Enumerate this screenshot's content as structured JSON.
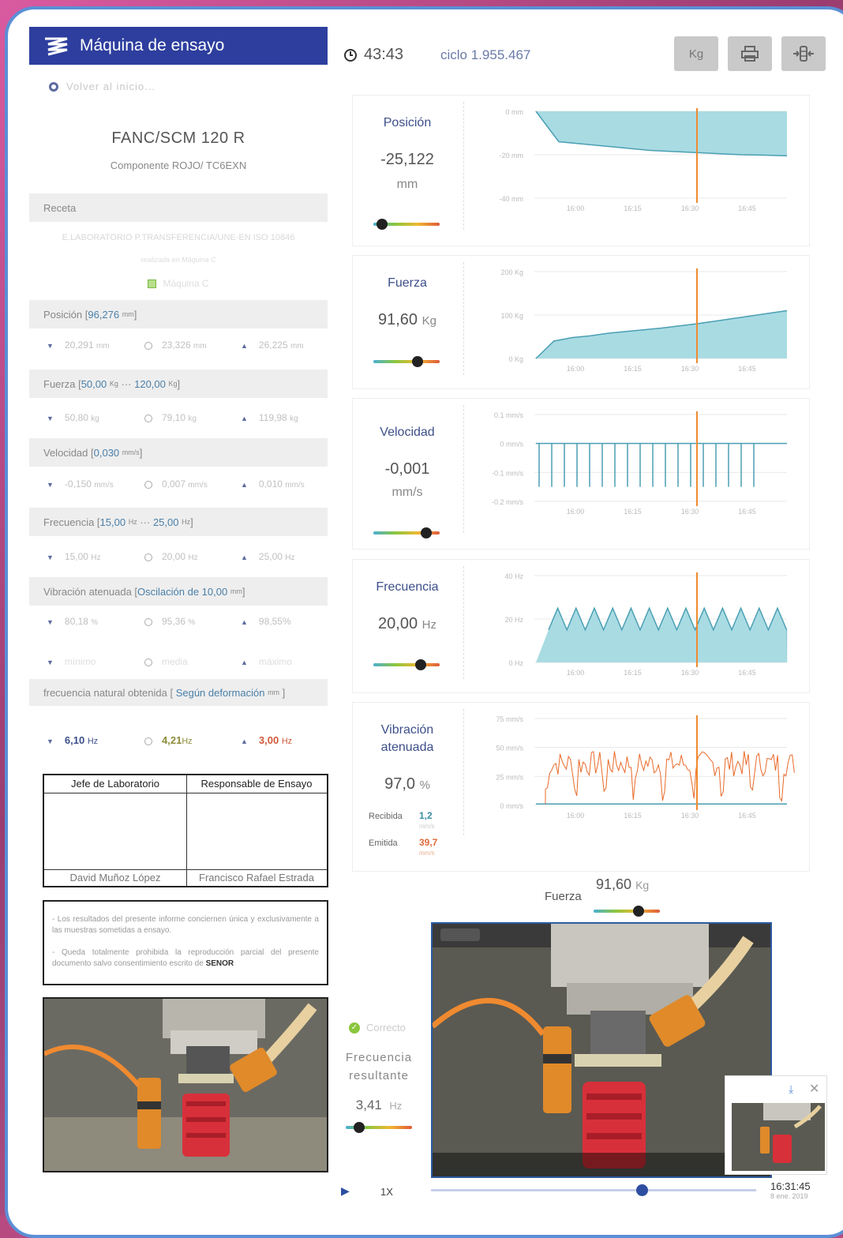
{
  "app": {
    "title": "Máquina de ensayo",
    "back_label": "Volver al inicio..."
  },
  "header": {
    "timer": "43:43",
    "ciclo": "ciclo 1.955.467",
    "unit_button": "Kg"
  },
  "specimen": {
    "model": "FANC/SCM 120 R",
    "component": "Componente ROJO/ TC6EXN"
  },
  "receta": {
    "label": "Receta",
    "recipe": "E.LABORATORIO P.TRANSFERENCIA/UNE-EN ISO 10846",
    "realizada": "realizada en Máquina C",
    "machine": "Máquina C"
  },
  "params": [
    {
      "title": "Posición",
      "value": "96,276",
      "unit": "mm",
      "min": "20,291",
      "min_unit": "mm",
      "avg": "23,326",
      "avg_unit": "mm",
      "max": "26,225",
      "max_unit": "mm"
    },
    {
      "title": "Fuerza",
      "value": "50,00",
      "unit": "Kg",
      "value2": "120,00",
      "unit2": "Kg",
      "min": "50,80",
      "min_unit": "kg",
      "avg": "79,10",
      "avg_unit": "kg",
      "max": "119,98",
      "max_unit": "kg"
    },
    {
      "title": "Velocidad",
      "value": "0,030",
      "unit": "mm/s",
      "min": "-0,150",
      "min_unit": "mm/s",
      "avg": "0,007",
      "avg_unit": "mm/s",
      "max": "0,010",
      "max_unit": "mm/s"
    },
    {
      "title": "Frecuencia",
      "value": "15,00",
      "unit": "Hz",
      "value2": "25,00",
      "unit2": "Hz",
      "min": "15,00",
      "min_unit": "Hz",
      "avg": "20,00",
      "avg_unit": "Hz",
      "max": "25,00",
      "max_unit": "Hz"
    },
    {
      "title": "Vibración atenuada",
      "value": "Oscilación de 10,00",
      "unit": "mm",
      "min": "80,18",
      "min_unit": "%",
      "avg": "95,36",
      "avg_unit": "%",
      "max": "98,55%",
      "max_unit": ""
    }
  ],
  "legend": {
    "min": "mínimo",
    "avg": "media",
    "max": "máximo"
  },
  "natural": {
    "title": "frecuencia natural obtenida",
    "method": "Según deformación",
    "unit": "mm",
    "min": "6,10",
    "avg": "4,21",
    "max": "3,00",
    "hz": "Hz"
  },
  "signatures": {
    "left_title": "Jefe de Laboratorio",
    "left_name": "David Muñoz López",
    "right_title": "Responsable de Ensayo",
    "right_name": "Francisco Rafael Estrada"
  },
  "notes": {
    "n1": "- Los resultados del presente informe conciernen única y exclusivamente a las muestras sometidas a ensayo.",
    "n2a": "- Queda totalmente prohibida la reproducción parcial del presente documento salvo consentimiento escrito de",
    "n2b": "SENOR"
  },
  "panels": {
    "posicion": {
      "label": "Posición",
      "value": "-25,122",
      "unit": "mm",
      "slider": 0.05
    },
    "fuerza": {
      "label": "Fuerza",
      "value": "91,60",
      "unit": "Kg",
      "slider": 0.7
    },
    "velocidad": {
      "label": "Velocidad",
      "value": "-0,001",
      "unit": "mm/s",
      "slider": 0.85
    },
    "frecuencia": {
      "label": "Frecuencia",
      "value": "20,00",
      "unit": "Hz",
      "slider": 0.75
    },
    "vibracion": {
      "label1": "Vibración",
      "label2": "atenuada",
      "value": "97,0",
      "unit": "%",
      "recibida_label": "Recibida",
      "recibida": "1,2",
      "recibida_unit": "mm/s",
      "emitida_label": "Emitida",
      "emitida": "39,7",
      "emitida_unit": "mm/s"
    }
  },
  "chart_data": [
    {
      "type": "area",
      "title": "",
      "x_ticks": [
        "16:00",
        "16:15",
        "16:30",
        "16:45"
      ],
      "y_ticks": [
        "0 mm",
        "-20 mm",
        "-40 mm"
      ],
      "ylim": [
        -40,
        0
      ],
      "series": [
        {
          "values": [
            0,
            -14,
            -15,
            -16,
            -17,
            -18,
            -18.5,
            -19,
            -19.5,
            -20,
            -20.2,
            -20.5
          ]
        }
      ],
      "marker_x": "16:30"
    },
    {
      "type": "area",
      "title": "",
      "x_ticks": [
        "16:00",
        "16:15",
        "16:30",
        "16:45"
      ],
      "y_ticks": [
        "200 Kg",
        "100 Kg",
        "0 Kg"
      ],
      "ylim": [
        0,
        200
      ],
      "series": [
        {
          "values": [
            0,
            40,
            48,
            52,
            58,
            62,
            66,
            70,
            75,
            80,
            86,
            92,
            98,
            104,
            110
          ]
        }
      ],
      "marker_x": "16:30"
    },
    {
      "type": "line",
      "title": "",
      "x_ticks": [
        "16:00",
        "16:15",
        "16:30",
        "16:45"
      ],
      "y_ticks": [
        "0.1 mm/s",
        "0 mm/s",
        "-0.1 mm/s",
        "-0.2 mm/s"
      ],
      "ylim": [
        -0.2,
        0.1
      ],
      "marker_x": "16:30"
    },
    {
      "type": "area",
      "title": "",
      "x_ticks": [
        "16:00",
        "16:15",
        "16:30",
        "16:45"
      ],
      "y_ticks": [
        "40 Hz",
        "20 Hz",
        "0 Hz"
      ],
      "ylim": [
        0,
        40
      ],
      "marker_x": "16:30"
    },
    {
      "type": "line",
      "title": "",
      "x_ticks": [
        "16:00",
        "16:15",
        "16:30",
        "16:45"
      ],
      "y_ticks": [
        "75 mm/s",
        "50 mm/s",
        "25 mm/s",
        "0 mm/s"
      ],
      "ylim": [
        0,
        75
      ],
      "marker_x": "16:30"
    }
  ],
  "bottom": {
    "fuerza_label": "Fuerza",
    "fuerza_value": "91,60",
    "fuerza_unit": "Kg",
    "correcto": "Correcto",
    "frec_label1": "Frecuencia",
    "frec_label2": "resultante",
    "frec_value": "3,41",
    "frec_unit": "Hz",
    "speed": "1X",
    "time": "16:31:45",
    "date": "8 ene. 2019",
    "timeline_progress": 0.65
  },
  "colors": {
    "brand": "#2d3e9e",
    "area": "#a9dbe3",
    "area_stroke": "#4a9fb3",
    "marker": "#f08a30",
    "emitted": "#e86a2a"
  }
}
